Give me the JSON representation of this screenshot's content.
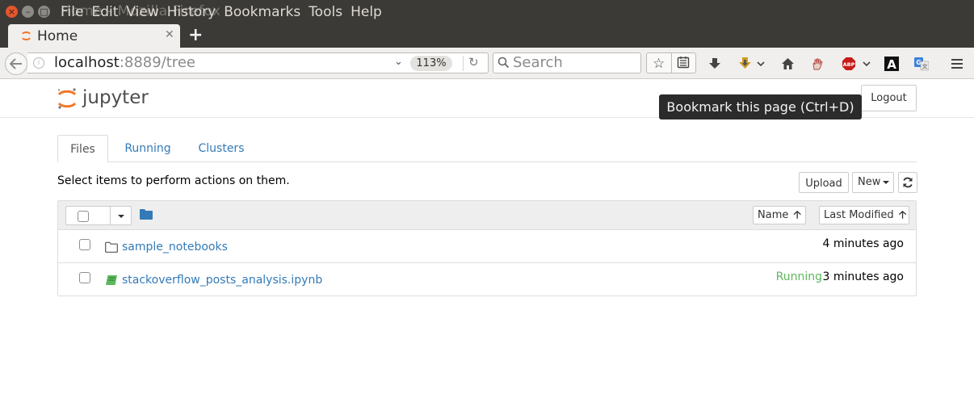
{
  "window": {
    "title": "Home - Mozilla Firefox",
    "menu": [
      "File",
      "Edit",
      "View",
      "History",
      "Bookmarks",
      "Tools",
      "Help"
    ]
  },
  "browser": {
    "tab_title": "Home",
    "url_host": "localhost",
    "url_rest": ":8889/tree",
    "zoom": "113%",
    "search_placeholder": "Search",
    "tooltip": "Bookmark this page (Ctrl+D)"
  },
  "jupyter": {
    "logo_text": "jupyter",
    "logout_label": "Logout",
    "tabs": [
      "Files",
      "Running",
      "Clusters"
    ],
    "select_message": "Select items to perform actions on them.",
    "upload_label": "Upload",
    "new_label": "New",
    "sort_name_label": "Name",
    "sort_modified_label": "Last Modified",
    "arrow": "🡡",
    "files": [
      {
        "name": "sample_notebooks",
        "type": "folder",
        "status": "",
        "modified": "4 minutes ago"
      },
      {
        "name": "stackoverflow_posts_analysis.ipynb",
        "type": "notebook",
        "status": "Running",
        "modified": "3 minutes ago"
      }
    ]
  },
  "colors": {
    "link": "#337ab7",
    "running": "#5cb85c",
    "jupyter_orange": "#f37726",
    "titlebar": "#3b3a37"
  }
}
